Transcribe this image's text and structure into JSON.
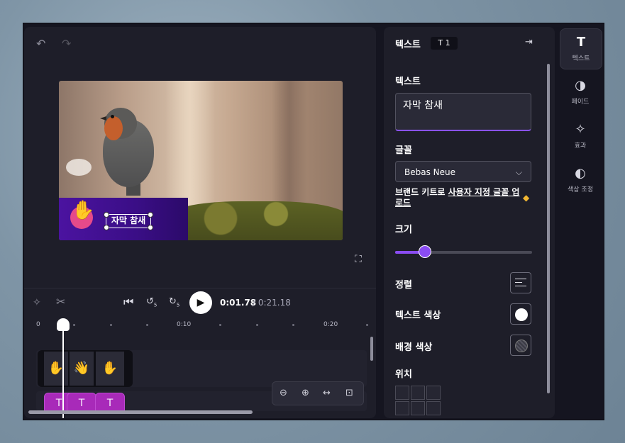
{
  "colors": {
    "accent": "#8a4cf2",
    "caption_banner": "#4b13a0",
    "text_clip": "#a82ab9",
    "favorite_diamond": "#f2b732"
  },
  "preview": {
    "undo_icon": "undo-icon",
    "redo_icon": "redo-icon",
    "caption_text": "자막 참새",
    "fullscreen_icon": "fullscreen-icon"
  },
  "playback": {
    "current_time": "0:01.78",
    "total_time": "/ 0:21.18",
    "skip_back_label": "5",
    "skip_forward_label": "5"
  },
  "timeline": {
    "ruler_labels": [
      "0",
      "0:10",
      "0:20"
    ],
    "text_clip_label": "T"
  },
  "properties": {
    "header_title": "텍스트",
    "badge_icon": "T",
    "badge_count": "1",
    "text_label": "텍스트",
    "text_value": "자막 참새",
    "font_label": "글꼴",
    "font_value": "Bebas Neue",
    "brand_kit_prefix": "브랜드 키트로 ",
    "brand_kit_link": "사용자 지정 글꼴 업로드",
    "size_label": "크기",
    "size_value_fraction": 0.22,
    "align_label": "정렬",
    "text_color_label": "텍스트 색상",
    "bg_color_label": "배경 색상",
    "position_label": "위치"
  },
  "side_tabs": [
    {
      "icon": "T",
      "label": "텍스트"
    },
    {
      "icon": "◑",
      "label": "페이드"
    },
    {
      "icon": "✧",
      "label": "효과"
    },
    {
      "icon": "◐",
      "label": "색상 조정"
    }
  ]
}
